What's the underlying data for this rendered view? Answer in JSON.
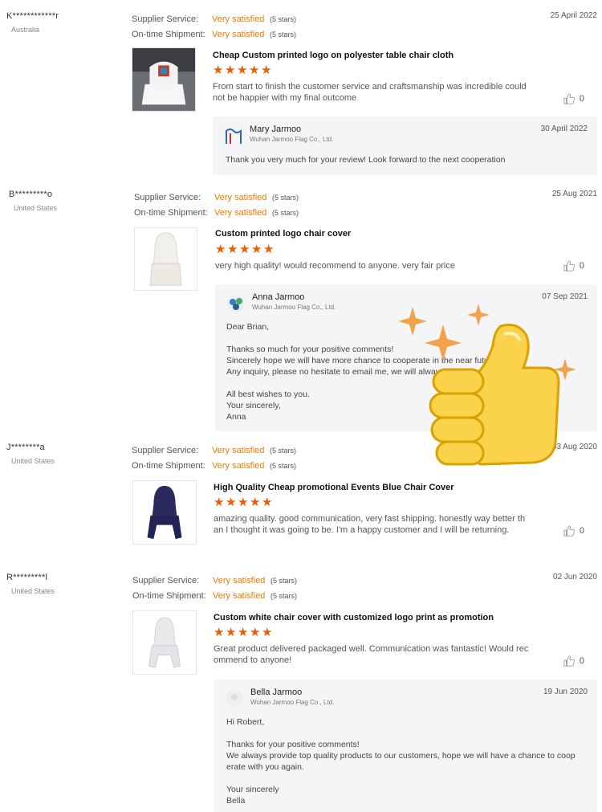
{
  "labels": {
    "supplier_service": "Supplier Service:",
    "on_time_shipment": "On-time Shipment:"
  },
  "colors": {
    "accent_orange": "#f07a00",
    "star_orange": "#f05a00",
    "reply_background": "#f5f5f7"
  },
  "icons": {
    "like": "thumbs-up-icon",
    "star": "star-icon",
    "sticker": "thumbs-up-sticker"
  },
  "reviews": [
    {
      "buyer": "K************r",
      "country": "Australia",
      "supplier_service": "Very satisfied",
      "supplier_service_stars": "(5 stars)",
      "on_time": "Very satisfied",
      "on_time_stars": "(5 stars)",
      "date": "25 April 2022",
      "product": "Cheap Custom printed logo on polyester table chair cloth",
      "stars": 5,
      "text": "From start to finish the customer service and craftsmanship was incredible could not be happier with my final outcome",
      "likes": "0",
      "reply": {
        "name": "Mary Jarmoo",
        "company": "Wuhan Jarmoo Flag Co., Ltd.",
        "date": "30 April 2022",
        "body": "Thank you very much for your review! Look forward to the next cooperation"
      }
    },
    {
      "buyer": "B*********o",
      "country": "United States",
      "supplier_service": "Very satisfied",
      "supplier_service_stars": "(5 stars)",
      "on_time": "Very satisfied",
      "on_time_stars": "(5 stars)",
      "date": "25 Aug 2021",
      "product": "Custom printed logo chair cover",
      "stars": 5,
      "text": "very high quality! would recommend to anyone. very fair price",
      "likes": "0",
      "reply": {
        "name": "Anna Jarmoo",
        "company": "Wuhan Jarmoo Flag Co., Ltd.",
        "date": "07 Sep 2021",
        "body": "Dear Brian,\n\nThanks so much for your positive comments!\nSincerely hope we will have more chance to cooperate in the near future.\nAny inquiry, please no hesitate to email me, we will always be here waiting for you !\n\nAll best wishes to you.\nYour sincerely,\nAnna"
      }
    },
    {
      "buyer": "J********a",
      "country": "United States",
      "supplier_service": "Very satisfied",
      "supplier_service_stars": "(5 stars)",
      "on_time": "Very satisfied",
      "on_time_stars": "(5 stars)",
      "date": "03 Aug 2020",
      "product": "High Quality Cheap promotional Events Blue Chair Cover",
      "stars": 5,
      "text": "amazing quality. good communication, very fast shipping.  honestly way better th\nan I thought it was going to be. I'm a happy customer and I will be returning.",
      "likes": "0"
    },
    {
      "buyer": "R*********l",
      "country": "United States",
      "supplier_service": "Very satisfied",
      "supplier_service_stars": "(5 stars)",
      "on_time": "Very satisfied",
      "on_time_stars": "(5 stars)",
      "date": "02 Jun 2020",
      "product": "Custom white chair cover with customized logo print as promotion",
      "stars": 5,
      "text": "Great product delivered packaged well.  Communication was fantastic!  Would rec\nommend to anyone!",
      "likes": "0",
      "reply": {
        "name": "Bella Jarmoo",
        "company": "Wuhan Jarmoo Flag Co., Ltd.",
        "date": "19 Jun 2020",
        "body": "Hi Robert,\n\nThanks for your positive comments!\nWe always provide top quality products to our customers, hope we will have a chance to coop\nerate with you again.\n\nYour sincerely\nBella"
      }
    }
  ]
}
